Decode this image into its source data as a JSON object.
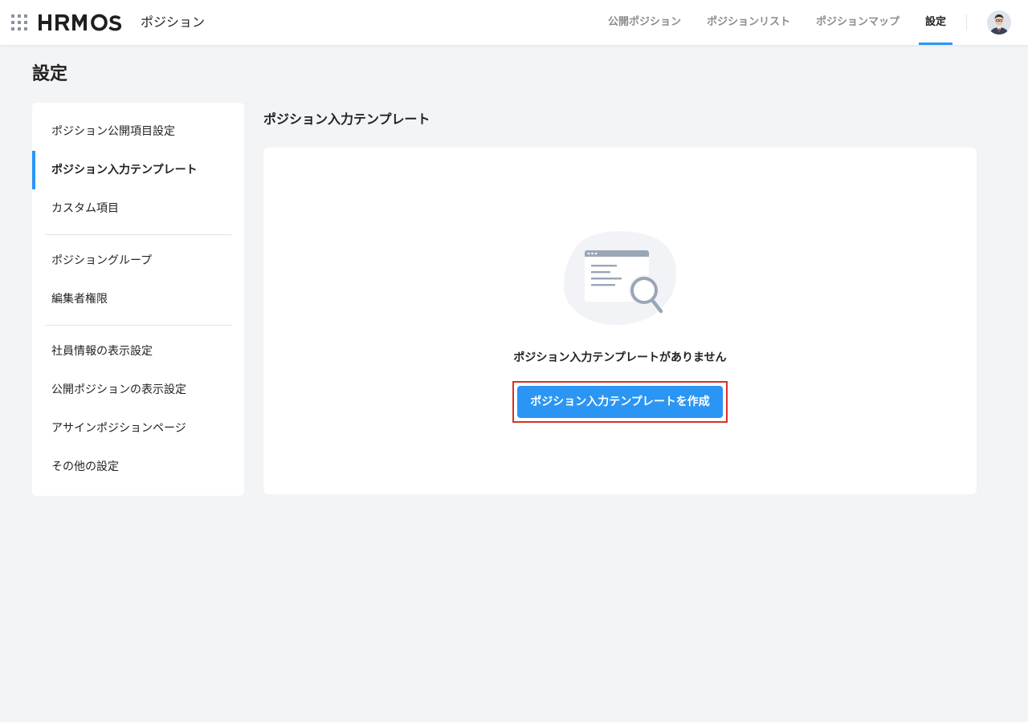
{
  "header": {
    "brand": "HRMOS",
    "app_name": "ポジション",
    "nav": [
      {
        "label": "公開ポジション",
        "active": false
      },
      {
        "label": "ポジションリスト",
        "active": false
      },
      {
        "label": "ポジションマップ",
        "active": false
      },
      {
        "label": "設定",
        "active": true
      }
    ],
    "accent_color": "#2b95f4"
  },
  "page": {
    "title": "設定"
  },
  "sidebar": {
    "groups": [
      [
        {
          "label": "ポジション公開項目設定",
          "active": false
        },
        {
          "label": "ポジション入力テンプレート",
          "active": true
        },
        {
          "label": "カスタム項目",
          "active": false
        }
      ],
      [
        {
          "label": "ポジショングループ",
          "active": false
        },
        {
          "label": "編集者権限",
          "active": false
        }
      ],
      [
        {
          "label": "社員情報の表示設定",
          "active": false
        },
        {
          "label": "公開ポジションの表示設定",
          "active": false
        },
        {
          "label": "アサインポジションページ",
          "active": false
        },
        {
          "label": "その他の設定",
          "active": false
        }
      ]
    ]
  },
  "main": {
    "section_title": "ポジション入力テンプレート",
    "empty_message": "ポジション入力テンプレートがありません",
    "create_button": "ポジション入力テンプレートを作成",
    "illustration_icon": "empty-search-icon"
  }
}
